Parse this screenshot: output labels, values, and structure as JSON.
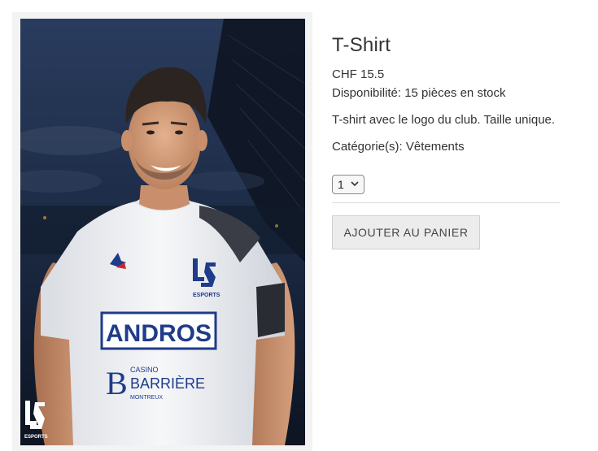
{
  "product": {
    "title": "T-Shirt",
    "price": "CHF 15.5",
    "availability": "Disponibilité: 15 pièces en stock",
    "description": "T-shirt avec le logo du club. Taille unique.",
    "category": "Catégorie(s): Vêtements",
    "quantity": "1",
    "add_to_cart_label": "AJOUTER AU PANIER"
  },
  "image": {
    "shirt_sponsor_main": "ANDROS",
    "shirt_sponsor_casino_top": "CASINO",
    "shirt_sponsor_casino_name": "BARRIÈRE",
    "shirt_sponsor_casino_city": "MONTREUX",
    "shirt_logo_text": "ESPORTS",
    "corner_logo_text": "ESPORTS"
  },
  "icons": {
    "quantity_dropdown": "chevron-down-icon",
    "team_logo": "ls-esports-logo",
    "kit_brand": "rooster-icon"
  },
  "colors": {
    "sponsor_blue": "#1f3b8a",
    "button_bg": "#ececec",
    "shirt_white": "#f4f5f7",
    "night_sky": "#1c2b45"
  }
}
